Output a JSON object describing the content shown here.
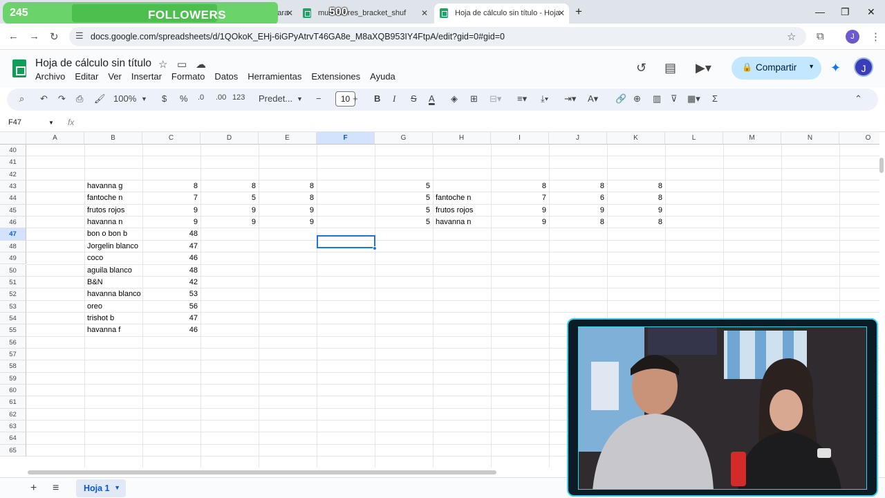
{
  "overlay": {
    "followers_count": "245",
    "followers_label": "FOLLOWERS",
    "goal": "500"
  },
  "browser": {
    "tabs": [
      {
        "title": "mejor software para"
      },
      {
        "title": "mun   fatores_bracket_shuf"
      },
      {
        "title": "Hoja de cálculo sin título - Hoja"
      }
    ],
    "url": "docs.google.com/spreadsheets/d/1QOkoK_EHj-6iGPyAtrvT46GA8e_M8aXQB953IY4FtpA/edit?gid=0#gid=0",
    "profile_initial": "J"
  },
  "app": {
    "title": "Hoja de cálculo sin título",
    "menu": [
      "Archivo",
      "Editar",
      "Ver",
      "Insertar",
      "Formato",
      "Datos",
      "Herramientas",
      "Extensiones",
      "Ayuda"
    ],
    "share_label": "Compartir",
    "avatar_initial": "J"
  },
  "toolbar": {
    "zoom": "100%",
    "currency": "$",
    "percent": "%",
    "dec_less": ".0",
    "dec_more": ".00",
    "format_123": "123",
    "font": "Predet...",
    "font_size": "10",
    "bold": "B",
    "italic": "I",
    "strike": "S",
    "text_color": "A"
  },
  "formula_bar": {
    "cell_ref": "F47",
    "fx": "fx"
  },
  "grid": {
    "columns": [
      "A",
      "B",
      "C",
      "D",
      "E",
      "F",
      "G",
      "H",
      "I",
      "J",
      "K",
      "L",
      "M",
      "N",
      "O"
    ],
    "selected_column": "F",
    "rows": [
      "40",
      "41",
      "42",
      "43",
      "44",
      "45",
      "46",
      "47",
      "48",
      "49",
      "50",
      "51",
      "52",
      "53",
      "54",
      "55",
      "56",
      "57",
      "58",
      "59",
      "60",
      "61",
      "62",
      "63",
      "64",
      "65"
    ],
    "selected_row": "47",
    "cells": [
      {
        "row": 43,
        "col": "B",
        "value": "havanna g"
      },
      {
        "row": 43,
        "col": "C",
        "value": "8",
        "num": true
      },
      {
        "row": 43,
        "col": "D",
        "value": "8",
        "num": true
      },
      {
        "row": 43,
        "col": "E",
        "value": "8",
        "num": true
      },
      {
        "row": 43,
        "col": "G",
        "value": "5",
        "num": true
      },
      {
        "row": 43,
        "col": "I",
        "value": "8",
        "num": true
      },
      {
        "row": 43,
        "col": "J",
        "value": "8",
        "num": true
      },
      {
        "row": 43,
        "col": "K",
        "value": "8",
        "num": true
      },
      {
        "row": 44,
        "col": "B",
        "value": "fantoche n"
      },
      {
        "row": 44,
        "col": "C",
        "value": "7",
        "num": true
      },
      {
        "row": 44,
        "col": "D",
        "value": "5",
        "num": true
      },
      {
        "row": 44,
        "col": "E",
        "value": "8",
        "num": true
      },
      {
        "row": 44,
        "col": "G",
        "value": "5",
        "num": true
      },
      {
        "row": 44,
        "col": "H",
        "value": "fantoche n"
      },
      {
        "row": 44,
        "col": "I",
        "value": "7",
        "num": true
      },
      {
        "row": 44,
        "col": "J",
        "value": "6",
        "num": true
      },
      {
        "row": 44,
        "col": "K",
        "value": "8",
        "num": true
      },
      {
        "row": 45,
        "col": "B",
        "value": "frutos rojos"
      },
      {
        "row": 45,
        "col": "C",
        "value": "9",
        "num": true
      },
      {
        "row": 45,
        "col": "D",
        "value": "9",
        "num": true
      },
      {
        "row": 45,
        "col": "E",
        "value": "9",
        "num": true
      },
      {
        "row": 45,
        "col": "G",
        "value": "5",
        "num": true
      },
      {
        "row": 45,
        "col": "H",
        "value": "frutos rojos"
      },
      {
        "row": 45,
        "col": "I",
        "value": "9",
        "num": true
      },
      {
        "row": 45,
        "col": "J",
        "value": "9",
        "num": true
      },
      {
        "row": 45,
        "col": "K",
        "value": "9",
        "num": true
      },
      {
        "row": 46,
        "col": "B",
        "value": "havanna n"
      },
      {
        "row": 46,
        "col": "C",
        "value": "9",
        "num": true
      },
      {
        "row": 46,
        "col": "D",
        "value": "9",
        "num": true
      },
      {
        "row": 46,
        "col": "E",
        "value": "9",
        "num": true
      },
      {
        "row": 46,
        "col": "G",
        "value": "5",
        "num": true
      },
      {
        "row": 46,
        "col": "H",
        "value": "havanna n"
      },
      {
        "row": 46,
        "col": "I",
        "value": "9",
        "num": true
      },
      {
        "row": 46,
        "col": "J",
        "value": "8",
        "num": true
      },
      {
        "row": 46,
        "col": "K",
        "value": "8",
        "num": true
      },
      {
        "row": 47,
        "col": "B",
        "value": "bon o bon b"
      },
      {
        "row": 47,
        "col": "C",
        "value": "48",
        "num": true
      },
      {
        "row": 48,
        "col": "B",
        "value": "Jorgelin blanco"
      },
      {
        "row": 48,
        "col": "C",
        "value": "47",
        "num": true
      },
      {
        "row": 49,
        "col": "B",
        "value": "coco"
      },
      {
        "row": 49,
        "col": "C",
        "value": "46",
        "num": true
      },
      {
        "row": 50,
        "col": "B",
        "value": "aguila blanco"
      },
      {
        "row": 50,
        "col": "C",
        "value": "48",
        "num": true
      },
      {
        "row": 51,
        "col": "B",
        "value": "B&N"
      },
      {
        "row": 51,
        "col": "C",
        "value": "42",
        "num": true
      },
      {
        "row": 52,
        "col": "B",
        "value": "havanna blanco"
      },
      {
        "row": 52,
        "col": "C",
        "value": "53",
        "num": true
      },
      {
        "row": 53,
        "col": "B",
        "value": "oreo"
      },
      {
        "row": 53,
        "col": "C",
        "value": "56",
        "num": true
      },
      {
        "row": 54,
        "col": "B",
        "value": "trishot b"
      },
      {
        "row": 54,
        "col": "C",
        "value": "47",
        "num": true
      },
      {
        "row": 55,
        "col": "B",
        "value": "havanna f"
      },
      {
        "row": 55,
        "col": "C",
        "value": "46",
        "num": true
      }
    ]
  },
  "sheets": {
    "active": "Hoja 1"
  }
}
